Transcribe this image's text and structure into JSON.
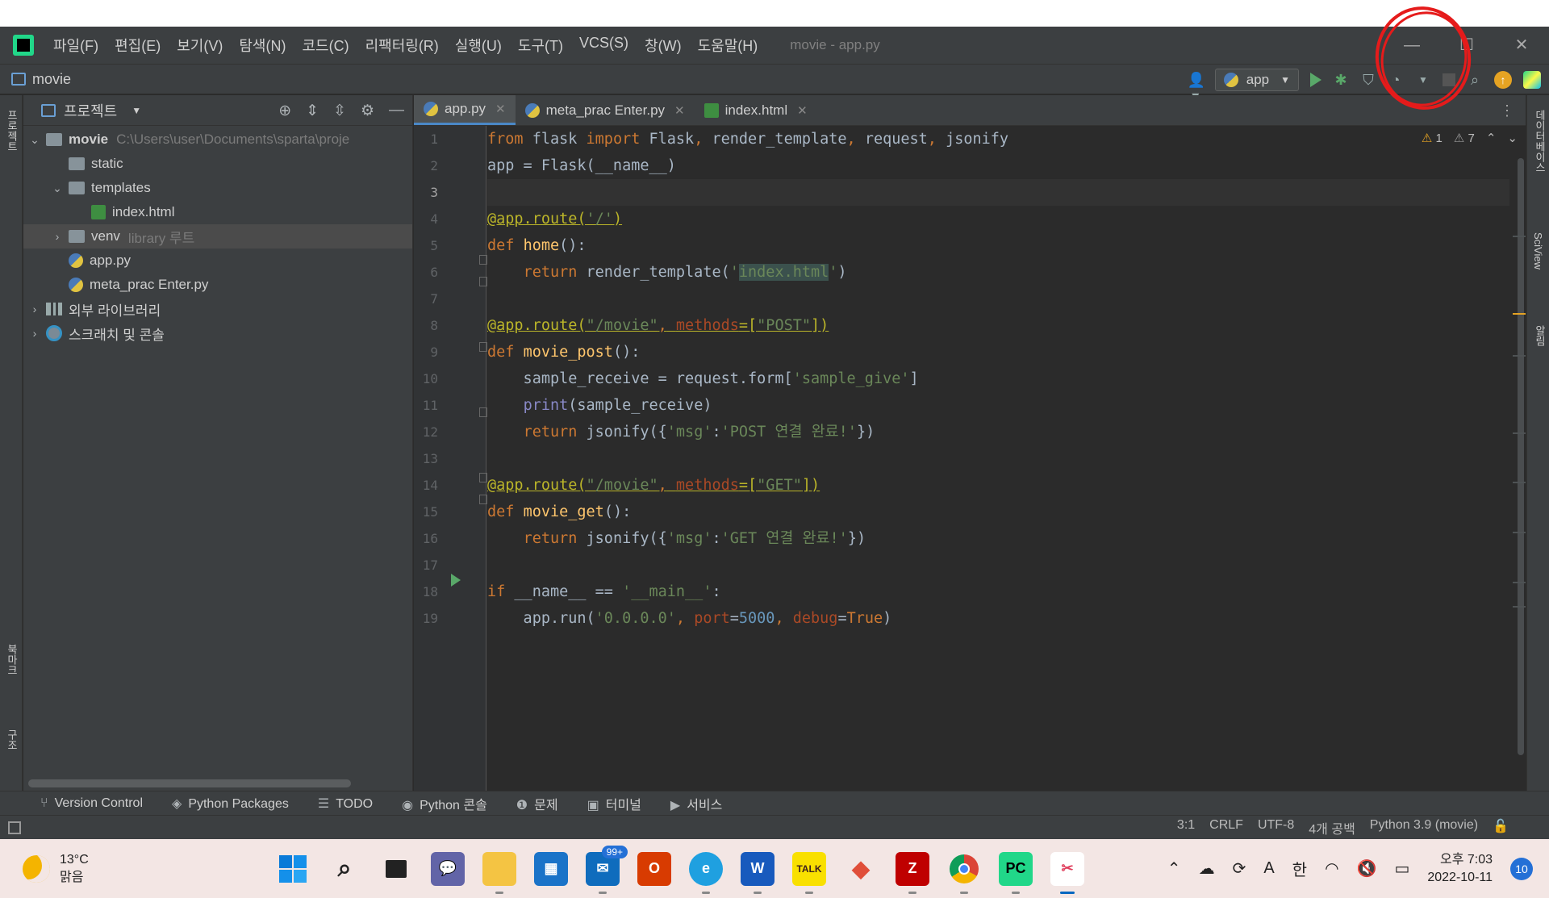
{
  "menu": [
    "파일(F)",
    "편집(E)",
    "보기(V)",
    "탐색(N)",
    "코드(C)",
    "리팩터링(R)",
    "실행(U)",
    "도구(T)",
    "VCS(S)",
    "창(W)",
    "도움말(H)"
  ],
  "window_title": "movie - app.py",
  "navbar": {
    "project": "movie",
    "run_config": "app"
  },
  "left_strip": {
    "project": "프로젝트",
    "bookmarks": "북마크",
    "structure": "구조"
  },
  "right_strip": {
    "database": "데이터베이스",
    "sciview": "SciView",
    "notifications": "알림"
  },
  "project_panel": {
    "title": "프로젝트",
    "tree": [
      {
        "label": "movie",
        "extra": "C:\\Users\\user\\Documents\\sparta\\proje"
      },
      {
        "label": "static"
      },
      {
        "label": "templates"
      },
      {
        "label": "index.html"
      },
      {
        "label": "venv",
        "extra": "library 루트"
      },
      {
        "label": "app.py"
      },
      {
        "label": "meta_prac Enter.py"
      },
      {
        "label": "외부 라이브러리"
      },
      {
        "label": "스크래치 및 콘솔"
      }
    ]
  },
  "tabs": [
    "app.py",
    "meta_prac Enter.py",
    "index.html"
  ],
  "inspections": {
    "warnings": "1",
    "weak_warnings": "7"
  },
  "line_numbers": [
    "1",
    "2",
    "3",
    "4",
    "5",
    "6",
    "7",
    "8",
    "9",
    "10",
    "11",
    "12",
    "13",
    "14",
    "15",
    "16",
    "17",
    "18",
    "19"
  ],
  "bottom_tools": [
    "Version Control",
    "Python Packages",
    "TODO",
    "Python 콘솔",
    "문제",
    "터미널",
    "서비스"
  ],
  "status": {
    "position": "3:1",
    "line_sep": "CRLF",
    "encoding": "UTF-8",
    "indent": "4개 공백",
    "interpreter": "Python 3.9 (movie)"
  },
  "taskbar": {
    "weather_temp": "13°C",
    "weather_desc": "맑음",
    "mail_badge": "99+",
    "ime": "A",
    "lang": "한",
    "time": "오후 7:03",
    "date": "2022-10-11",
    "notif_count": "10"
  }
}
